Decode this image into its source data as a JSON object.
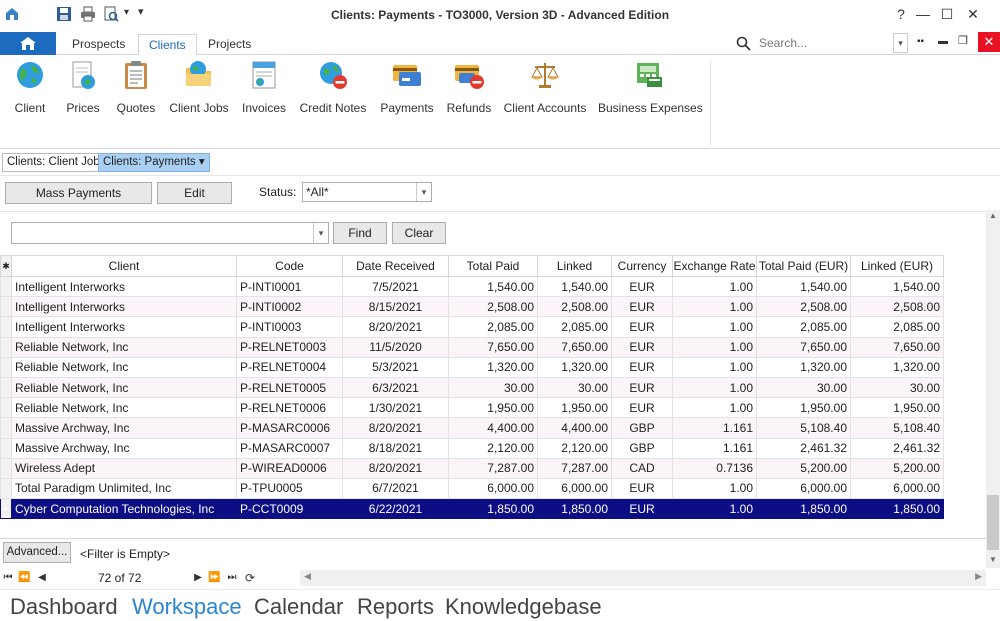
{
  "window": {
    "title": "Clients: Payments - TO3000, Version 3D - Advanced Edition",
    "help": "?",
    "minimize": "—",
    "maximize": "☐",
    "close": "✕"
  },
  "ribbon_tabs": [
    {
      "label": "Prospects"
    },
    {
      "label": "Clients"
    },
    {
      "label": "Projects"
    }
  ],
  "search": {
    "placeholder": "Search..."
  },
  "ribbon_buttons": [
    {
      "label": "Client"
    },
    {
      "label": "Prices"
    },
    {
      "label": "Quotes"
    },
    {
      "label": "Client Jobs"
    },
    {
      "label": "Invoices"
    },
    {
      "label": "Credit Notes"
    },
    {
      "label": "Payments"
    },
    {
      "label": "Refunds"
    },
    {
      "label": "Client Accounts"
    },
    {
      "label": "Business Expenses"
    }
  ],
  "doc_tabs": [
    {
      "label": "Clients: Client Jobs"
    },
    {
      "label": "Clients: Payments ▾"
    }
  ],
  "toolbar": {
    "mass_payments": "Mass Payments",
    "edit": "Edit",
    "status_label": "Status:",
    "status_value": "*All*"
  },
  "filter": {
    "value": "",
    "find": "Find",
    "clear": "Clear"
  },
  "grid": {
    "columns": [
      "Client",
      "Code",
      "Date Received",
      "Total Paid",
      "Linked",
      "Currency",
      "Exchange Rate",
      "Total Paid (EUR)",
      "Linked (EUR)"
    ],
    "rows": [
      [
        "Intelligent Interworks",
        "P-INTI0001",
        "7/5/2021",
        "1,540.00",
        "1,540.00",
        "EUR",
        "1.00",
        "1,540.00",
        "1,540.00"
      ],
      [
        "Intelligent Interworks",
        "P-INTI0002",
        "8/15/2021",
        "2,508.00",
        "2,508.00",
        "EUR",
        "1.00",
        "2,508.00",
        "2,508.00"
      ],
      [
        "Intelligent Interworks",
        "P-INTI0003",
        "8/20/2021",
        "2,085.00",
        "2,085.00",
        "EUR",
        "1.00",
        "2,085.00",
        "2,085.00"
      ],
      [
        "Reliable Network, Inc",
        "P-RELNET0003",
        "11/5/2020",
        "7,650.00",
        "7,650.00",
        "EUR",
        "1.00",
        "7,650.00",
        "7,650.00"
      ],
      [
        "Reliable Network, Inc",
        "P-RELNET0004",
        "5/3/2021",
        "1,320.00",
        "1,320.00",
        "EUR",
        "1.00",
        "1,320.00",
        "1,320.00"
      ],
      [
        "Reliable Network, Inc",
        "P-RELNET0005",
        "6/3/2021",
        "30.00",
        "30.00",
        "EUR",
        "1.00",
        "30.00",
        "30.00"
      ],
      [
        "Reliable Network, Inc",
        "P-RELNET0006",
        "1/30/2021",
        "1,950.00",
        "1,950.00",
        "EUR",
        "1.00",
        "1,950.00",
        "1,950.00"
      ],
      [
        "Massive Archway, Inc",
        "P-MASARC0006",
        "8/20/2021",
        "4,400.00",
        "4,400.00",
        "GBP",
        "1.161",
        "5,108.40",
        "5,108.40"
      ],
      [
        "Massive Archway, Inc",
        "P-MASARC0007",
        "8/18/2021",
        "2,120.00",
        "2,120.00",
        "GBP",
        "1.161",
        "2,461.32",
        "2,461.32"
      ],
      [
        "Wireless Adept",
        "P-WIREAD0006",
        "8/20/2021",
        "7,287.00",
        "7,287.00",
        "CAD",
        "0.7136",
        "5,200.00",
        "5,200.00"
      ],
      [
        "Total Paradigm Unlimited, Inc",
        "P-TPU0005",
        "6/7/2021",
        "6,000.00",
        "6,000.00",
        "EUR",
        "1.00",
        "6,000.00",
        "6,000.00"
      ],
      [
        "Cyber Computation Technologies, Inc",
        "P-CCT0009",
        "6/22/2021",
        "1,850.00",
        "1,850.00",
        "EUR",
        "1.00",
        "1,850.00",
        "1,850.00"
      ]
    ],
    "selected_row": 11
  },
  "status": {
    "advanced": "Advanced...",
    "filter_text": "<Filter is Empty>",
    "record_counter": "72 of 72"
  },
  "bottom_nav": [
    {
      "label": "Dashboard"
    },
    {
      "label": "Workspace"
    },
    {
      "label": "Calendar"
    },
    {
      "label": "Reports"
    },
    {
      "label": "Knowledgebase"
    }
  ],
  "colors": {
    "accent": "#1c6bbf",
    "selection": "#0d0d84",
    "active_nav": "#2a86d1"
  }
}
